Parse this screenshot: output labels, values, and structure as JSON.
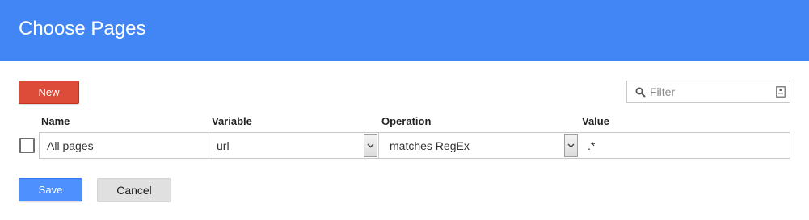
{
  "dialog": {
    "title": "Choose Pages"
  },
  "toolbar": {
    "new_label": "New",
    "filter_placeholder": "Filter"
  },
  "columns": {
    "name": "Name",
    "variable": "Variable",
    "operation": "Operation",
    "value": "Value"
  },
  "rows": [
    {
      "checked": false,
      "name": "All pages",
      "variable": "url",
      "operation": "matches RegEx",
      "value": ".*"
    }
  ],
  "actions": {
    "save_label": "Save",
    "cancel_label": "Cancel"
  },
  "colors": {
    "header": "#4285f4",
    "new_button": "#dd4b39",
    "save_button": "#4d90fe",
    "cancel_button": "#e0e0e0"
  }
}
